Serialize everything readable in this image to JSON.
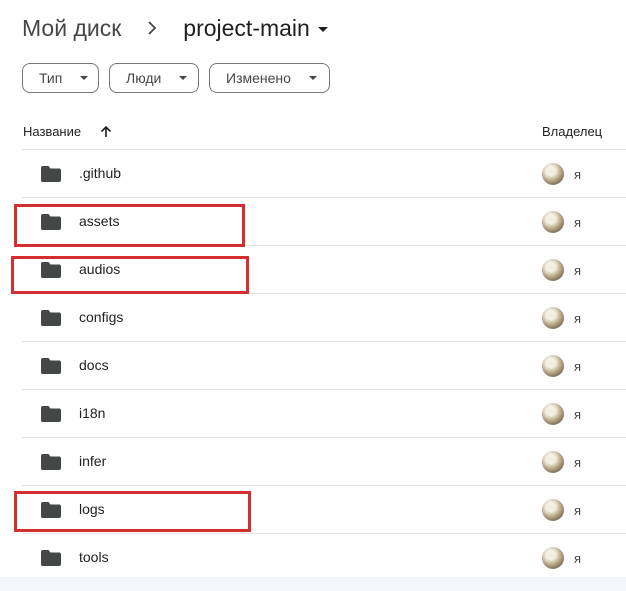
{
  "breadcrumb": {
    "root": "Мой диск",
    "current": "project-main"
  },
  "filters": [
    {
      "label": "Тип"
    },
    {
      "label": "Люди"
    },
    {
      "label": "Изменено"
    }
  ],
  "table": {
    "col_name": "Название",
    "col_owner": "Владелец",
    "sort": "ascending",
    "rows": [
      {
        "name": ".github",
        "owner": "я"
      },
      {
        "name": "assets",
        "owner": "я"
      },
      {
        "name": "audios",
        "owner": "я"
      },
      {
        "name": "configs",
        "owner": "я"
      },
      {
        "name": "docs",
        "owner": "я"
      },
      {
        "name": "i18n",
        "owner": "я"
      },
      {
        "name": "infer",
        "owner": "я"
      },
      {
        "name": "logs",
        "owner": "я"
      },
      {
        "name": "tools",
        "owner": "я"
      }
    ]
  },
  "highlighted_rows": [
    "assets",
    "audios",
    "logs"
  ],
  "colors": {
    "highlight": "#d32f2f",
    "folder_icon": "#444746",
    "divider": "#e1e3e1"
  }
}
